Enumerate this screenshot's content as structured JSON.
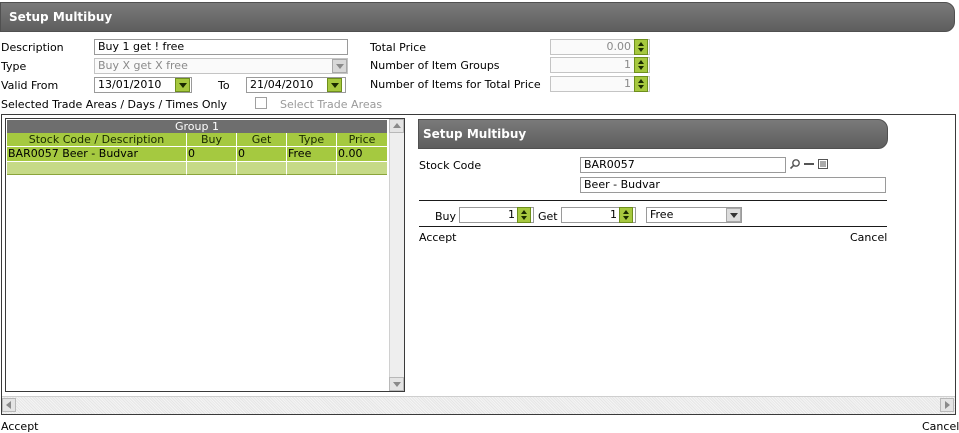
{
  "window": {
    "title": "Setup Multibuy"
  },
  "form": {
    "description_label": "Description",
    "description_value": "Buy 1 get ! free",
    "type_label": "Type",
    "type_value": "Buy X get X free",
    "valid_from_label": "Valid From",
    "valid_from_value": "13/01/2010",
    "to_label": "To",
    "to_value": "21/04/2010",
    "selected_trade_label": "Selected Trade Areas / Days / Times Only",
    "select_trade_areas_label": "Select Trade Areas",
    "total_price_label": "Total Price",
    "total_price_value": "0.00",
    "item_groups_label": "Number of Item Groups",
    "item_groups_value": "1",
    "items_total_label": "Number of Items for Total Price",
    "items_total_value": "1"
  },
  "grid": {
    "group_title": "Group 1",
    "columns": [
      "Stock Code / Description",
      "Buy",
      "Get",
      "Type",
      "Price"
    ],
    "rows": [
      [
        "BAR0057 Beer - Budvar",
        "0",
        "0",
        "Free",
        "0.00"
      ]
    ]
  },
  "editor": {
    "title": "Setup Multibuy",
    "stock_code_label": "Stock Code",
    "stock_code_value": "BAR0057",
    "stock_desc_value": "Beer - Budvar",
    "buy_label": "Buy",
    "buy_value": "1",
    "get_label": "Get",
    "get_value": "1",
    "type_value": "Free",
    "accept_label": "Accept",
    "cancel_label": "Cancel"
  },
  "footer": {
    "accept_label": "Accept",
    "cancel_label": "Cancel"
  },
  "colors": {
    "accent_green": "#a5c940",
    "title_grey": "#6a6a6a"
  }
}
